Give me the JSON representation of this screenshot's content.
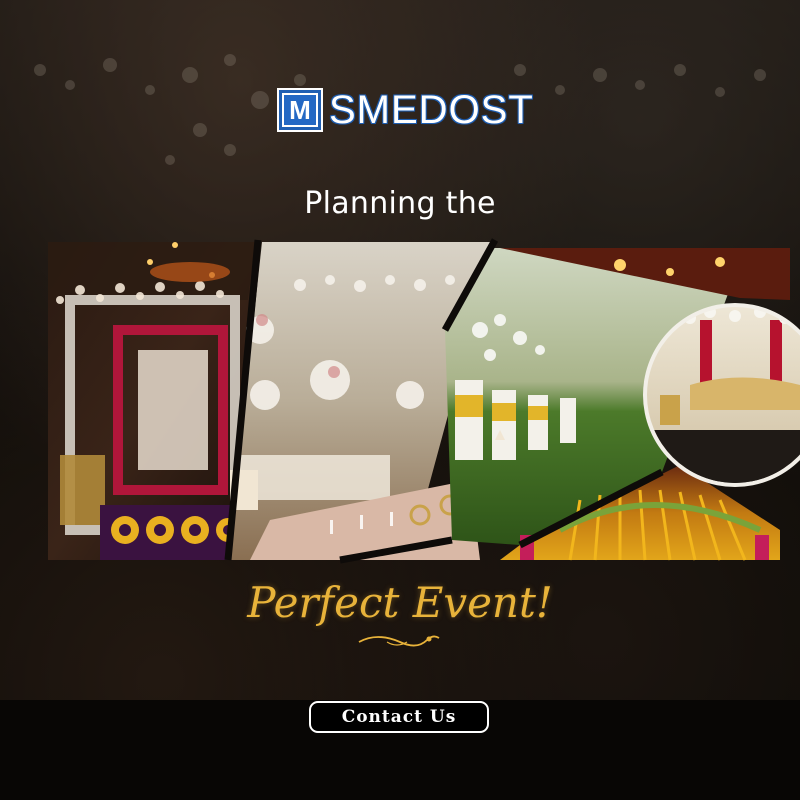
{
  "brand": {
    "logo_letter": "M",
    "name": "SMEDOST",
    "color": "#1f5fb3"
  },
  "headline": "Planning the",
  "tagline": "Perfect Event!",
  "cta": {
    "label": "Contact Us"
  },
  "colors": {
    "accent_gold": "#e8b33a",
    "text_white": "#ffffff",
    "background": "#0b0907"
  },
  "collage_panels": [
    {
      "name": "red-floral-stage-photo"
    },
    {
      "name": "white-floral-hall-photo"
    },
    {
      "name": "garden-lawn-setup-photo"
    },
    {
      "name": "gold-marigold-decor-photo"
    },
    {
      "name": "white-stage-sofa-photo"
    }
  ]
}
